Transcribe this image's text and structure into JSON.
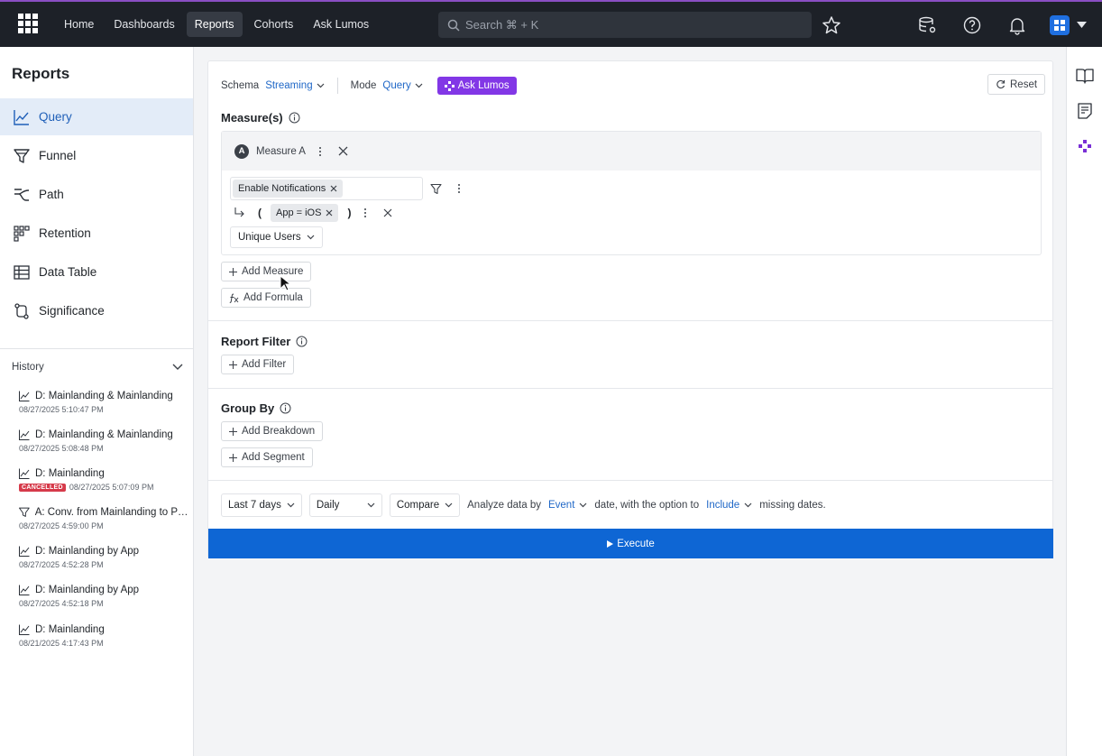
{
  "topnav": {
    "links": [
      "Home",
      "Dashboards",
      "Reports",
      "Cohorts",
      "Ask Lumos"
    ],
    "active": "Reports",
    "search_placeholder": "Search ⌘ + K"
  },
  "sidebar": {
    "title": "Reports",
    "items": [
      {
        "label": "Query",
        "icon": "line-chart-icon",
        "active": true
      },
      {
        "label": "Funnel",
        "icon": "funnel-icon"
      },
      {
        "label": "Path",
        "icon": "path-icon"
      },
      {
        "label": "Retention",
        "icon": "retention-icon"
      },
      {
        "label": "Data Table",
        "icon": "table-icon"
      },
      {
        "label": "Significance",
        "icon": "significance-icon"
      }
    ]
  },
  "history": {
    "label": "History",
    "items": [
      {
        "title": "D: Mainlanding & Mainlanding",
        "date": "08/27/2025 5:10:47 PM",
        "icon": "line-chart-icon"
      },
      {
        "title": "D: Mainlanding & Mainlanding",
        "date": "08/27/2025 5:08:48 PM",
        "icon": "line-chart-icon"
      },
      {
        "title": "D: Mainlanding",
        "date": "08/27/2025 5:07:09 PM",
        "icon": "line-chart-icon",
        "status": "CANCELLED"
      },
      {
        "title": "A: Conv. from Mainlanding to Pu...",
        "date": "08/27/2025 4:59:00 PM",
        "icon": "funnel-icon"
      },
      {
        "title": "D: Mainlanding by App",
        "date": "08/27/2025 4:52:28 PM",
        "icon": "line-chart-icon"
      },
      {
        "title": "D: Mainlanding by App",
        "date": "08/27/2025 4:52:18 PM",
        "icon": "line-chart-icon"
      },
      {
        "title": "D: Mainlanding",
        "date": "08/21/2025 4:17:43 PM",
        "icon": "line-chart-icon"
      }
    ]
  },
  "toolbar": {
    "schema_label": "Schema",
    "schema_value": "Streaming",
    "mode_label": "Mode",
    "mode_value": "Query",
    "ask_lumos": "Ask Lumos",
    "reset": "Reset"
  },
  "measures": {
    "title": "Measure(s)",
    "measure_badge": "A",
    "measure_name": "Measure A",
    "event_chip": "Enable Notifications",
    "open_paren": "(",
    "close_paren": ")",
    "filter_chip": "App = iOS",
    "aggregation": "Unique Users",
    "add_measure": "Add Measure",
    "add_formula": "Add Formula"
  },
  "report_filter": {
    "title": "Report Filter",
    "add_filter": "Add Filter"
  },
  "group_by": {
    "title": "Group By",
    "add_breakdown": "Add Breakdown",
    "add_segment": "Add Segment"
  },
  "time": {
    "range": "Last 7 days",
    "granularity": "Daily",
    "compare": "Compare",
    "analyze_prefix": "Analyze data by",
    "analyze_value": "Event",
    "analyze_mid": "date, with the option to",
    "include_value": "Include",
    "analyze_suffix": "missing dates."
  },
  "execute": "Execute",
  "colors": {
    "nav_bg": "#1d2128",
    "accent_blue": "#0e66d4",
    "lumos_purple": "#8237e6",
    "active_item_bg": "#e3ecf8",
    "cancelled_red": "#d63a4a"
  }
}
